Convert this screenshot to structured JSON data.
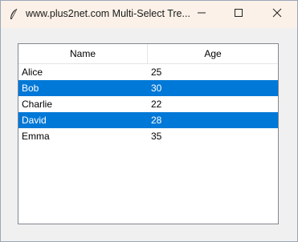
{
  "window": {
    "title": "www.plus2net.com Multi-Select Tre...",
    "icon": "tk-feather-icon"
  },
  "controls": {
    "minimize_icon": "minimize-icon",
    "maximize_icon": "maximize-icon",
    "close_icon": "close-icon"
  },
  "tree": {
    "columns": [
      "Name",
      "Age"
    ],
    "rows": [
      {
        "name": "Alice",
        "age": "25",
        "selected": false
      },
      {
        "name": "Bob",
        "age": "30",
        "selected": true
      },
      {
        "name": "Charlie",
        "age": "22",
        "selected": false
      },
      {
        "name": "David",
        "age": "28",
        "selected": true
      },
      {
        "name": "Emma",
        "age": "35",
        "selected": false
      }
    ]
  },
  "colors": {
    "selection": "#0078d7",
    "titlebar": "#fbf1e8",
    "window_bg": "#f0f0f0"
  }
}
